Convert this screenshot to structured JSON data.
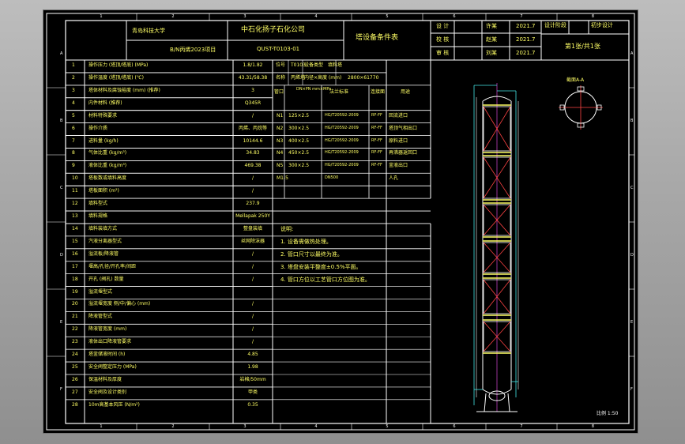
{
  "frame": {
    "top_numbers": [
      "1",
      "2",
      "3",
      "4",
      "5",
      "6",
      "7",
      "8"
    ],
    "left_letters": [
      "A",
      "B",
      "C",
      "D",
      "E",
      "F"
    ]
  },
  "title_block": {
    "institution": "青岛科技大学",
    "drawing_title_left": "B/N丙烯2023项目",
    "company": "中石化扬子石化公司",
    "drawing_no": "QUST-T0103-01",
    "doc_title": "塔设备条件表",
    "roles": [
      "设 计",
      "校 核",
      "审 核"
    ],
    "names": [
      "许某",
      "赵某",
      "刘某"
    ],
    "dates": [
      "2021.7",
      "2021.7",
      "2021.7"
    ],
    "stage_label": "设计阶段",
    "stage_value": "初步设计",
    "sheet_info": "第1张/共1张"
  },
  "params": {
    "rows": [
      {
        "no": "1",
        "label": "操作压力 (塔顶/塔底) (MPa)",
        "value": "1.8/1.82"
      },
      {
        "no": "2",
        "label": "操作温度 (塔顶/塔底) (℃)",
        "value": "43.31/58.38"
      },
      {
        "no": "3",
        "label": "塔体材料及腐蚀裕度 (mm) (推荐)",
        "value": "3"
      },
      {
        "no": "4",
        "label": "内件材料 (推荐)",
        "value": "Q345R"
      },
      {
        "no": "5",
        "label": "材料特殊要求",
        "value": "/"
      },
      {
        "no": "6",
        "label": "操作介质",
        "value": "丙烯、丙烷等"
      },
      {
        "no": "7",
        "label": "进料量 (kg/h)",
        "value": "10144.6"
      },
      {
        "no": "8",
        "label": "气体比重 (kg/m³)",
        "value": "34.83"
      },
      {
        "no": "9",
        "label": "液体比重 (kg/m³)",
        "value": "469.38"
      },
      {
        "no": "10",
        "label": "塔板数或填料高度",
        "value": "/"
      },
      {
        "no": "11",
        "label": "塔板面积 (m²)",
        "value": "/"
      },
      {
        "no": "12",
        "label": "填料型式",
        "value": "237.9"
      },
      {
        "no": "13",
        "label": "填料规格",
        "value": "Mellapak 250Y"
      },
      {
        "no": "14",
        "label": "填料装填方式",
        "value": "整盘装填"
      },
      {
        "no": "15",
        "label": "汽液分离器型式",
        "value": "丝网除沫器"
      },
      {
        "no": "16",
        "label": "溢流板/降液管",
        "value": "/"
      },
      {
        "no": "17",
        "label": "堰高/孔径/开孔率/间距",
        "value": "/"
      },
      {
        "no": "18",
        "label": "开孔 (阀孔) 数量",
        "value": "/"
      },
      {
        "no": "19",
        "label": "溢流堰型式",
        "value": ""
      },
      {
        "no": "20",
        "label": "溢流堰宽度 侧/中/偏心 (mm)",
        "value": "/"
      },
      {
        "no": "21",
        "label": "降液管型式",
        "value": "/"
      },
      {
        "no": "22",
        "label": "降液管宽度 (mm)",
        "value": "/"
      },
      {
        "no": "23",
        "label": "液体出口降液管要求",
        "value": "/"
      },
      {
        "no": "24",
        "label": "塔釜储液时间 (h)",
        "value": "4.85"
      },
      {
        "no": "25",
        "label": "安全阀整定压力 (MPa)",
        "value": "1.98"
      },
      {
        "no": "26",
        "label": "保温材料及厚度",
        "value": "岩棉/50mm"
      },
      {
        "no": "27",
        "label": "安全阀及设计类别",
        "value": "甲类"
      },
      {
        "no": "28",
        "label": "10m高基本风压 (N/m²)",
        "value": "0.35"
      }
    ]
  },
  "equipment": {
    "h_no": "位号",
    "v_no": "T0103",
    "h_name": "名称",
    "v_name": "丙烯塔",
    "h_dims": "内径×高度 (mm)",
    "v_dims": "2800×61770",
    "h_type": "设备类型",
    "v_type": "填料塔"
  },
  "nozzles": {
    "headers": [
      "管口",
      "DN×PN mm×MPa",
      "法兰标准",
      "连接面",
      "用途"
    ],
    "rows": [
      {
        "id": "N1",
        "size": "125×2.5",
        "std": "HG/T20592-2009",
        "face": "RF-FF",
        "use": "回流进口"
      },
      {
        "id": "N2",
        "size": "300×2.5",
        "std": "HG/T20592-2009",
        "face": "RF-FF",
        "use": "塔顶气相出口"
      },
      {
        "id": "N3",
        "size": "400×2.5",
        "std": "HG/T20592-2009",
        "face": "RF-FF",
        "use": "原料进口"
      },
      {
        "id": "N4",
        "size": "450×2.5",
        "std": "HG/T20592-2009",
        "face": "RF-FF",
        "use": "再沸器返回口"
      },
      {
        "id": "N5",
        "size": "300×2.5",
        "std": "HG/T20592-2009",
        "face": "RF-FF",
        "use": "釜液出口"
      },
      {
        "id": "M1-5",
        "size": "",
        "std": "DN500",
        "face": "",
        "use": "人孔"
      }
    ]
  },
  "notes": {
    "heading": "说明:",
    "items": [
      "1. 设备需做热处理。",
      "2. 管口尺寸以最终为准。",
      "3. 塔盘安装平整度±0.5%平面。",
      "4. 管口方位以工艺管口方位图为准。"
    ]
  },
  "drawing": {
    "section_label": "截面A-A",
    "scale": "比例 1:50"
  }
}
